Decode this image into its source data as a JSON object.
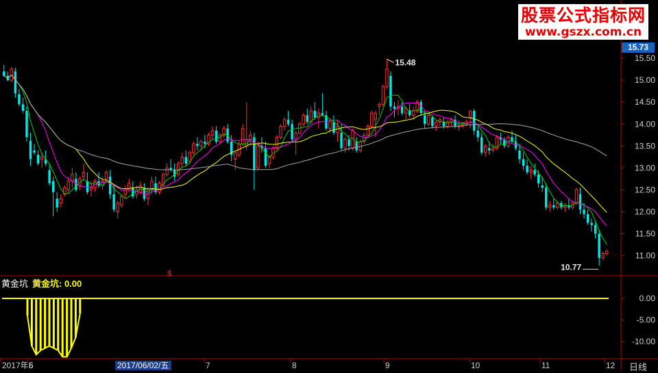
{
  "watermark": {
    "title": "股票公式指标网",
    "url": "www.gszx.com.cn"
  },
  "last_price": "15.73",
  "sub_panel": {
    "name": "黄金坑",
    "value_label": "黄金坑: 0.00"
  },
  "date_cursor": "2017/06/02/五",
  "period_label": "日线",
  "top_marker": "$",
  "chart_data": [
    {
      "type": "candlestick",
      "price_axis": {
        "ticks": [
          "15.50",
          "15.00",
          "14.50",
          "14.00",
          "13.50",
          "13.00",
          "12.50",
          "12.00",
          "11.50",
          "11.00"
        ],
        "ylim": [
          10.62,
          15.86
        ]
      },
      "time_axis": {
        "ticks": [
          "2017年5",
          "6",
          "7",
          "8",
          "9",
          "10",
          "11",
          "12"
        ]
      },
      "annotations": [
        {
          "label": "15.48",
          "value": 15.48,
          "kind": "high"
        },
        {
          "label": "10.77",
          "value": 10.77,
          "kind": "low"
        }
      ],
      "candles": [
        [
          15.2,
          15.35,
          15.08,
          15.1
        ],
        [
          15.1,
          15.2,
          14.98,
          15.0
        ],
        [
          15.0,
          15.3,
          14.95,
          15.25
        ],
        [
          15.2,
          15.28,
          14.6,
          14.7
        ],
        [
          14.68,
          14.8,
          14.4,
          14.45
        ],
        [
          14.45,
          14.6,
          14.25,
          14.3
        ],
        [
          14.3,
          14.4,
          13.6,
          13.7
        ],
        [
          13.62,
          13.8,
          13.05,
          13.2
        ],
        [
          13.4,
          13.55,
          13.3,
          13.35
        ],
        [
          13.3,
          13.4,
          13.05,
          13.1
        ],
        [
          13.2,
          13.35,
          13.0,
          13.25
        ],
        [
          13.2,
          13.4,
          13.05,
          13.1
        ],
        [
          12.95,
          13.1,
          12.6,
          12.65
        ],
        [
          12.7,
          12.8,
          11.9,
          12.45
        ],
        [
          12.3,
          12.45,
          12.0,
          12.1
        ],
        [
          12.2,
          12.4,
          12.1,
          12.3
        ],
        [
          12.4,
          12.6,
          12.35,
          12.55
        ],
        [
          12.5,
          12.8,
          12.4,
          12.7
        ],
        [
          12.7,
          13.0,
          12.55,
          12.85
        ],
        [
          12.75,
          12.9,
          12.45,
          12.5
        ],
        [
          12.6,
          12.8,
          12.5,
          12.75
        ],
        [
          12.8,
          13.1,
          12.7,
          12.9
        ],
        [
          12.7,
          12.9,
          12.4,
          12.45
        ],
        [
          12.5,
          12.7,
          12.35,
          12.55
        ],
        [
          12.55,
          12.75,
          12.45,
          12.7
        ],
        [
          12.7,
          12.9,
          12.55,
          12.6
        ],
        [
          12.6,
          12.8,
          12.5,
          12.7
        ],
        [
          12.75,
          12.95,
          12.65,
          12.9
        ],
        [
          12.8,
          12.95,
          12.3,
          12.4
        ],
        [
          12.4,
          12.6,
          12.0,
          12.05
        ],
        [
          12.0,
          12.25,
          11.85,
          12.2
        ],
        [
          12.15,
          12.4,
          12.1,
          12.35
        ],
        [
          12.4,
          12.6,
          12.3,
          12.5
        ],
        [
          12.5,
          12.75,
          12.45,
          12.65
        ],
        [
          12.55,
          12.7,
          12.3,
          12.35
        ],
        [
          12.4,
          12.6,
          12.3,
          12.5
        ],
        [
          12.45,
          12.7,
          12.4,
          12.6
        ],
        [
          12.55,
          12.65,
          12.25,
          12.3
        ],
        [
          12.3,
          12.55,
          12.15,
          12.5
        ],
        [
          12.5,
          12.8,
          12.4,
          12.7
        ],
        [
          12.65,
          12.8,
          12.4,
          12.45
        ],
        [
          12.45,
          12.7,
          12.4,
          12.65
        ],
        [
          12.6,
          12.9,
          12.55,
          12.85
        ],
        [
          12.85,
          13.1,
          12.8,
          13.0
        ],
        [
          13.0,
          13.2,
          12.9,
          12.95
        ],
        [
          12.95,
          13.1,
          12.7,
          12.8
        ],
        [
          12.85,
          13.15,
          12.8,
          13.1
        ],
        [
          13.1,
          13.35,
          13.0,
          13.25
        ],
        [
          13.25,
          13.4,
          13.05,
          13.1
        ],
        [
          13.15,
          13.4,
          13.1,
          13.35
        ],
        [
          13.35,
          13.6,
          13.3,
          13.55
        ],
        [
          13.55,
          13.7,
          13.4,
          13.5
        ],
        [
          13.5,
          13.65,
          13.4,
          13.6
        ],
        [
          13.6,
          13.75,
          13.45,
          13.55
        ],
        [
          13.55,
          13.8,
          13.5,
          13.75
        ],
        [
          13.75,
          13.95,
          13.65,
          13.85
        ],
        [
          13.85,
          13.95,
          13.55,
          13.6
        ],
        [
          13.6,
          13.8,
          13.55,
          13.75
        ],
        [
          13.75,
          13.95,
          13.7,
          13.9
        ],
        [
          13.9,
          14.0,
          13.55,
          13.6
        ],
        [
          13.6,
          13.75,
          13.15,
          13.3
        ],
        [
          13.2,
          13.4,
          12.95,
          13.35
        ],
        [
          13.3,
          13.6,
          13.25,
          13.55
        ],
        [
          13.55,
          14.0,
          13.5,
          13.9
        ],
        [
          13.5,
          14.5,
          13.4,
          13.65
        ],
        [
          13.65,
          13.85,
          13.5,
          13.75
        ],
        [
          13.7,
          13.8,
          12.5,
          12.95
        ],
        [
          13.0,
          13.6,
          12.95,
          13.5
        ],
        [
          13.5,
          13.7,
          13.35,
          13.45
        ],
        [
          13.45,
          13.6,
          13.0,
          13.05
        ],
        [
          13.1,
          13.3,
          13.0,
          13.25
        ],
        [
          13.25,
          13.5,
          13.2,
          13.45
        ],
        [
          13.45,
          13.75,
          13.4,
          13.7
        ],
        [
          13.7,
          14.0,
          13.65,
          13.95
        ],
        [
          13.95,
          14.15,
          13.85,
          14.1
        ],
        [
          14.1,
          14.3,
          13.95,
          14.0
        ],
        [
          14.0,
          14.1,
          13.6,
          13.65
        ],
        [
          13.65,
          13.85,
          13.3,
          13.8
        ],
        [
          13.8,
          14.05,
          13.75,
          14.0
        ],
        [
          14.0,
          14.25,
          13.95,
          14.2
        ],
        [
          14.2,
          14.35,
          14.0,
          14.05
        ],
        [
          14.05,
          14.4,
          14.0,
          14.3
        ],
        [
          14.3,
          14.5,
          14.1,
          14.15
        ],
        [
          14.15,
          14.35,
          13.9,
          14.25
        ],
        [
          14.25,
          14.7,
          14.2,
          14.2
        ],
        [
          14.2,
          14.3,
          13.85,
          13.9
        ],
        [
          13.9,
          14.1,
          13.8,
          14.05
        ],
        [
          14.05,
          14.2,
          13.75,
          13.8
        ],
        [
          13.8,
          14.1,
          13.6,
          13.95
        ],
        [
          13.8,
          14.0,
          13.4,
          13.45
        ],
        [
          13.45,
          13.7,
          13.35,
          13.65
        ],
        [
          13.65,
          13.75,
          13.4,
          13.5
        ],
        [
          13.45,
          13.9,
          13.4,
          13.85
        ],
        [
          13.6,
          13.7,
          13.35,
          13.4
        ],
        [
          13.4,
          13.65,
          13.35,
          13.6
        ],
        [
          13.6,
          13.8,
          13.55,
          13.75
        ],
        [
          13.75,
          14.0,
          13.7,
          13.95
        ],
        [
          13.95,
          14.3,
          13.9,
          14.25
        ],
        [
          14.1,
          14.3,
          13.7,
          14.25
        ],
        [
          14.4,
          14.5,
          14.2,
          14.45
        ],
        [
          14.45,
          14.9,
          14.4,
          14.85
        ],
        [
          14.85,
          15.48,
          14.8,
          15.25
        ],
        [
          15.1,
          15.2,
          14.3,
          14.4
        ],
        [
          14.4,
          14.5,
          14.15,
          14.35
        ],
        [
          14.35,
          14.55,
          14.2,
          14.4
        ],
        [
          14.4,
          14.5,
          14.2,
          14.25
        ],
        [
          14.25,
          14.4,
          14.1,
          14.35
        ],
        [
          14.3,
          14.45,
          14.15,
          14.2
        ],
        [
          14.2,
          14.4,
          14.1,
          14.3
        ],
        [
          14.3,
          14.55,
          14.25,
          14.5
        ],
        [
          14.5,
          14.55,
          14.2,
          14.25
        ],
        [
          14.2,
          14.3,
          13.9,
          14.0
        ],
        [
          14.0,
          14.25,
          13.95,
          14.2
        ],
        [
          14.15,
          14.2,
          13.9,
          13.95
        ],
        [
          13.95,
          14.1,
          13.85,
          14.05
        ],
        [
          14.05,
          14.15,
          13.95,
          14.1
        ],
        [
          14.05,
          14.15,
          13.9,
          13.95
        ],
        [
          13.95,
          14.1,
          13.9,
          14.05
        ],
        [
          14.05,
          14.15,
          13.95,
          14.1
        ],
        [
          14.1,
          14.2,
          13.9,
          13.95
        ],
        [
          13.95,
          14.1,
          13.85,
          13.95
        ],
        [
          13.95,
          14.05,
          13.9,
          14.0
        ],
        [
          14.0,
          14.1,
          13.95,
          14.05
        ],
        [
          14.15,
          14.3,
          13.9,
          14.3
        ],
        [
          14.3,
          14.35,
          13.75,
          13.85
        ],
        [
          13.85,
          13.95,
          13.6,
          13.7
        ],
        [
          13.7,
          13.8,
          13.3,
          13.35
        ],
        [
          13.35,
          13.55,
          13.25,
          13.5
        ],
        [
          13.45,
          13.6,
          13.3,
          13.4
        ],
        [
          13.4,
          13.55,
          13.35,
          13.45
        ],
        [
          13.45,
          13.75,
          13.4,
          13.7
        ],
        [
          13.7,
          13.8,
          13.55,
          13.65
        ],
        [
          13.65,
          13.7,
          13.45,
          13.5
        ],
        [
          13.5,
          13.75,
          13.45,
          13.7
        ],
        [
          13.7,
          13.85,
          13.55,
          13.6
        ],
        [
          13.6,
          13.75,
          13.4,
          13.45
        ],
        [
          13.4,
          13.55,
          13.1,
          13.2
        ],
        [
          13.2,
          13.35,
          12.95,
          13.05
        ],
        [
          13.05,
          13.2,
          12.85,
          12.9
        ],
        [
          12.9,
          13.05,
          12.75,
          12.95
        ],
        [
          12.95,
          13.1,
          12.8,
          12.85
        ],
        [
          12.85,
          12.95,
          12.55,
          12.65
        ],
        [
          12.6,
          12.8,
          12.45,
          12.55
        ],
        [
          12.55,
          12.65,
          12.05,
          12.1
        ],
        [
          12.1,
          12.25,
          12.0,
          12.15
        ],
        [
          12.15,
          12.3,
          12.05,
          12.1
        ],
        [
          12.1,
          12.25,
          12.05,
          12.2
        ],
        [
          12.2,
          12.25,
          12.05,
          12.1
        ],
        [
          12.1,
          12.2,
          12.0,
          12.15
        ],
        [
          12.15,
          12.3,
          12.05,
          12.1
        ],
        [
          12.1,
          12.25,
          12.05,
          12.2
        ],
        [
          12.2,
          12.55,
          12.15,
          12.5
        ],
        [
          12.4,
          12.55,
          11.95,
          12.05
        ],
        [
          12.05,
          12.2,
          11.85,
          11.95
        ],
        [
          11.95,
          12.05,
          11.7,
          11.75
        ],
        [
          11.75,
          11.85,
          11.55,
          11.7
        ],
        [
          11.7,
          11.8,
          11.4,
          11.5
        ],
        [
          11.5,
          11.6,
          10.77,
          10.95
        ],
        [
          10.95,
          11.1,
          10.9,
          11.05
        ],
        [
          11.05,
          11.15,
          11.0,
          11.1
        ]
      ],
      "overlays": [
        {
          "label": "5-day",
          "color": "#00d000",
          "period": 5
        },
        {
          "label": "10-day",
          "color": "#ff00ff",
          "period": 10
        },
        {
          "label": "20-day",
          "color": "#ffff00",
          "period": 20
        },
        {
          "label": "60-day",
          "color": "#a8a8a8",
          "period": 60
        }
      ],
      "colors": {
        "up": "#ff3030",
        "down": "#00e8e8",
        "border": "#b30000",
        "axis_text": "#cfcfcf"
      }
    },
    {
      "type": "bar",
      "title": "黄金坑",
      "series_name": "黄金坑",
      "current_value": 0.0,
      "y_ticks": [
        "0.00",
        "-5.00",
        "-10.00"
      ],
      "ylim": [
        -13.6,
        3.8
      ],
      "line_value": 0,
      "values": [
        -4.0,
        -11.0,
        -13.0,
        -12.0,
        -11.5,
        -11.0,
        -11.5,
        -12.0,
        -13.5,
        -13.5,
        -11.5,
        -9.0,
        -3.5
      ],
      "color": "#ffff00"
    }
  ]
}
